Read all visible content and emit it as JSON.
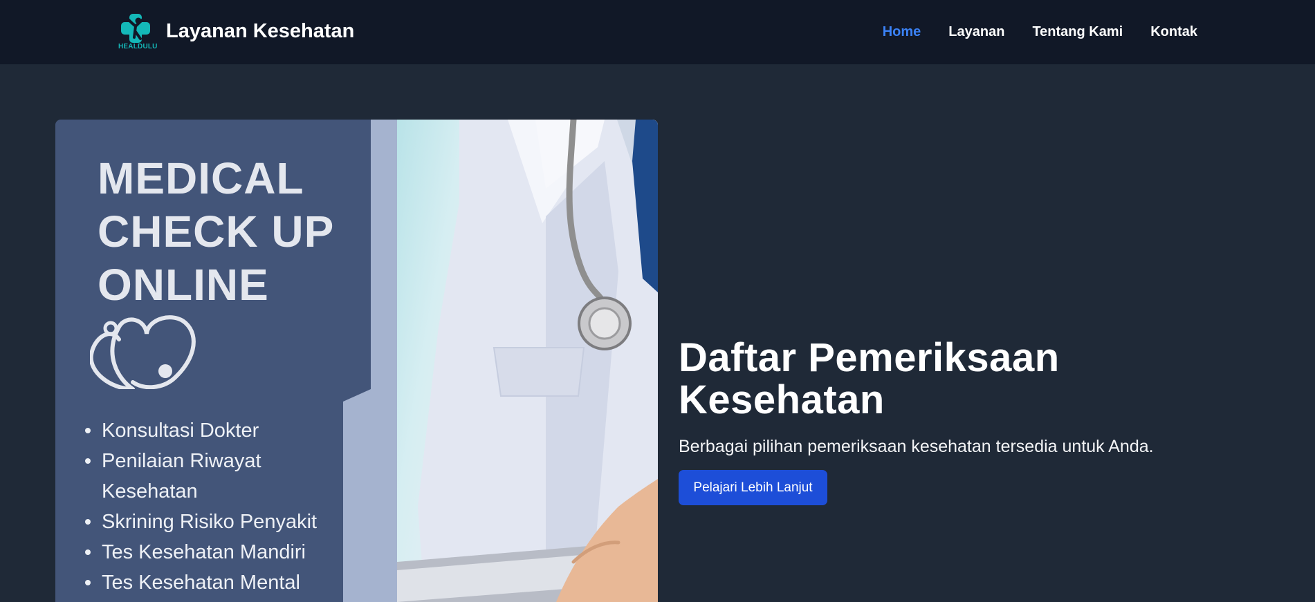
{
  "header": {
    "logo_text": "HEALDULU",
    "brand_title": "Layanan Kesehatan",
    "nav": [
      {
        "label": "Home",
        "active": true
      },
      {
        "label": "Layanan",
        "active": false
      },
      {
        "label": "Tentang Kami",
        "active": false
      },
      {
        "label": "Kontak",
        "active": false
      }
    ]
  },
  "banner": {
    "heading_lines": [
      "MEDICAL",
      "CHECK UP",
      "ONLINE"
    ],
    "list": [
      "Konsultasi Dokter",
      "Penilaian Riwayat Kesehatan",
      "Skrining Risiko Penyakit",
      "Tes Kesehatan Mandiri",
      "Tes Kesehatan Mental"
    ]
  },
  "hero": {
    "title": "Daftar Pemeriksaan Kesehatan",
    "subtitle": "Berbagai pilihan pemeriksaan kesehatan tersedia untuk Anda.",
    "button_label": "Pelajari Lebih Lanjut"
  },
  "colors": {
    "page_bg": "#1f2937",
    "navbar_bg": "#111827",
    "active_link": "#3b82f6",
    "button_bg": "#1d4ed8",
    "banner_navy": "#435579",
    "logo_teal": "#14b8b8"
  }
}
